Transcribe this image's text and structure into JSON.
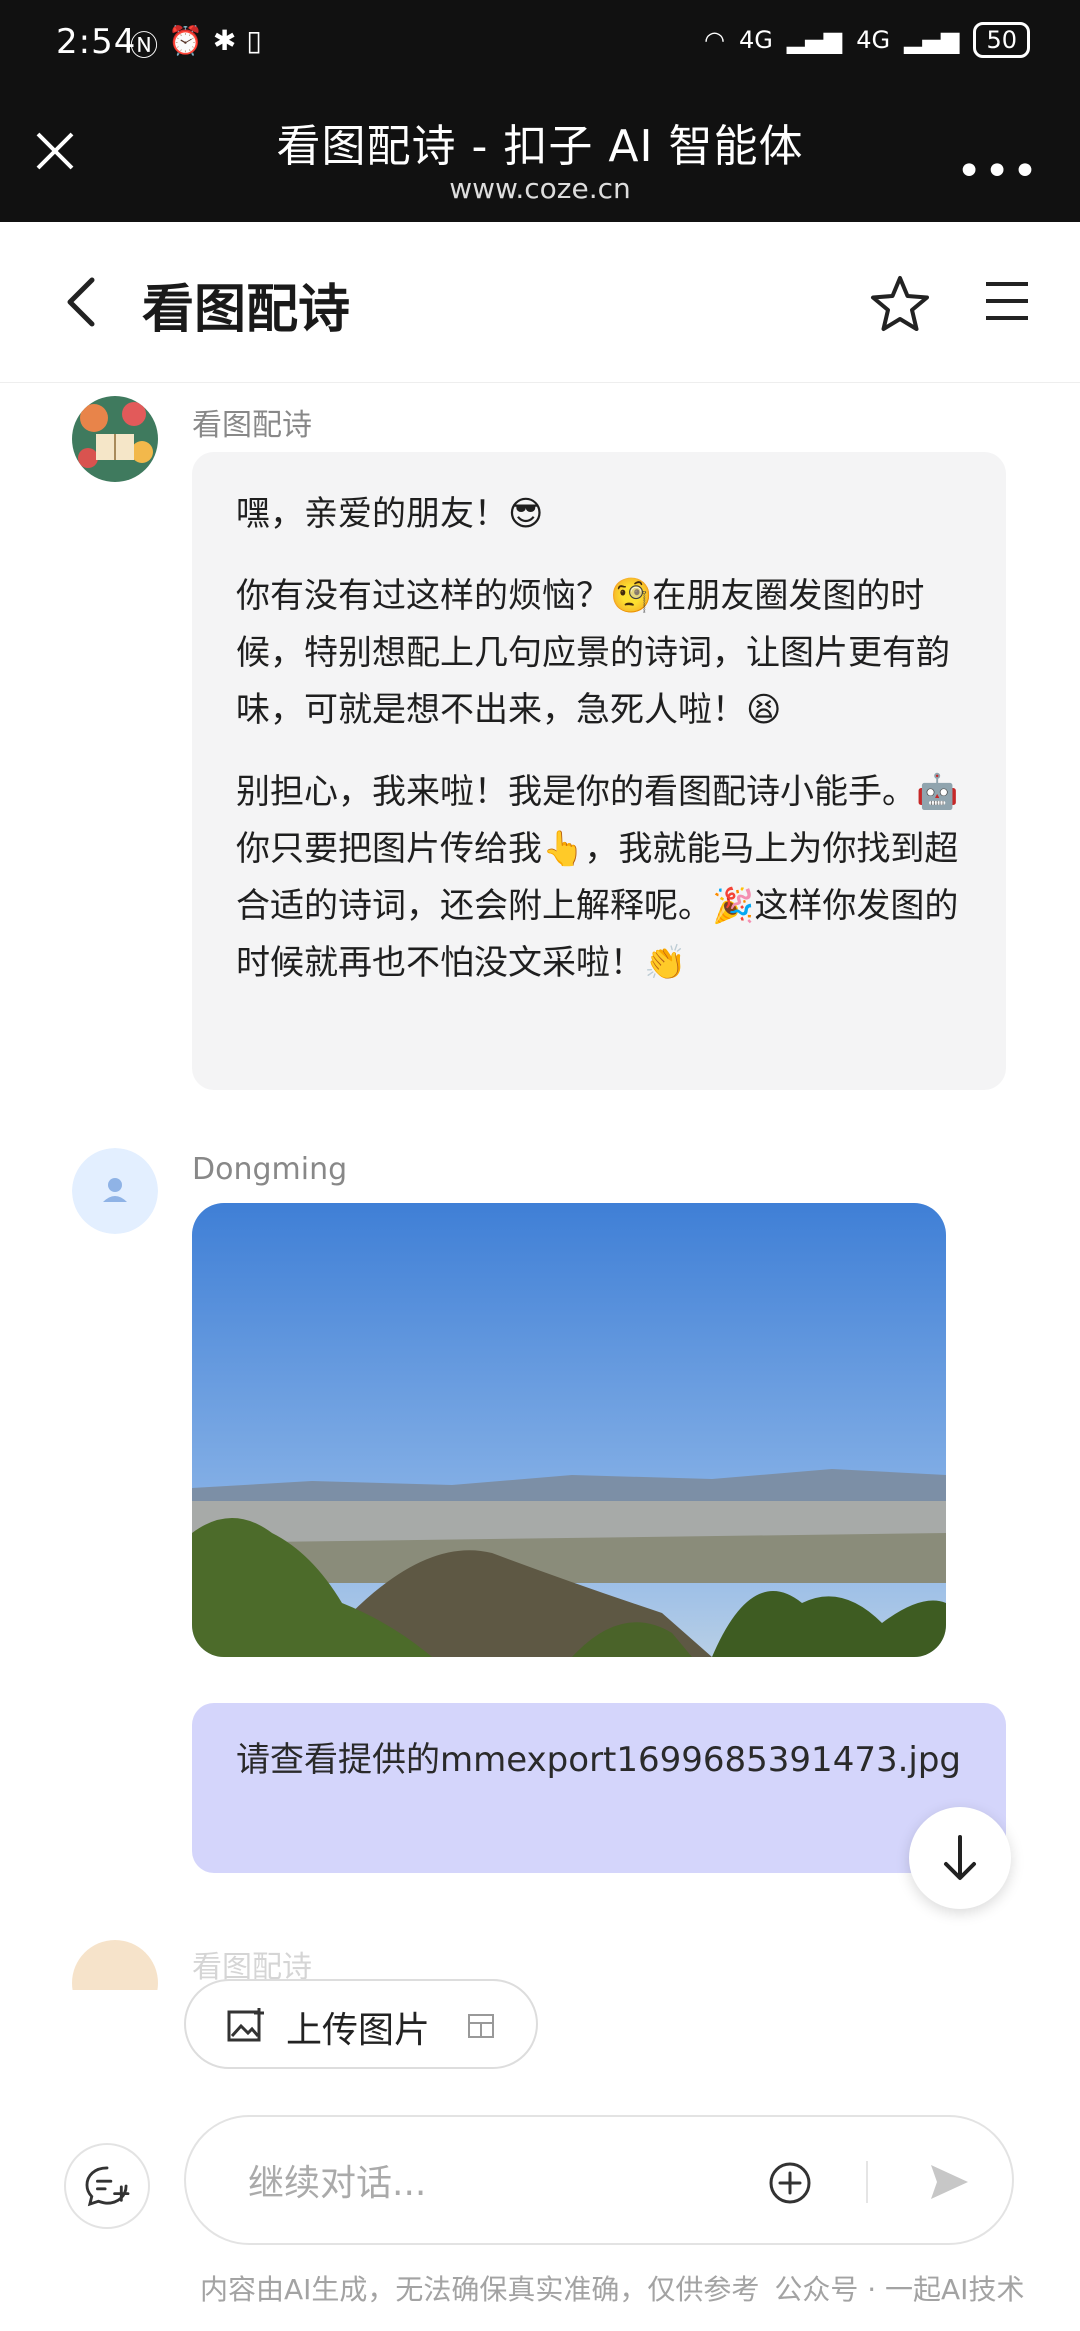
{
  "status_bar": {
    "time": "2:54",
    "network_1": "4G",
    "network_2": "4G",
    "battery": "50"
  },
  "browser": {
    "title": "看图配诗 - 扣子 AI 智能体",
    "url": "www.coze.cn"
  },
  "header": {
    "title": "看图配诗"
  },
  "messages": {
    "bot": {
      "sender": "看图配诗",
      "paragraphs": [
        "嘿，亲爱的朋友！😎",
        "你有没有过这样的烦恼？🧐在朋友圈发图的时候，特别想配上几句应景的诗词，让图片更有韵味，可就是想不出来，急死人啦！😫",
        "别担心，我来啦！我是你的看图配诗小能手。🤖你只要把图片传给我👆，我就能马上为你找到超合适的诗词，还会附上解释呢。🎉这样你发图的时候就再也不怕没文采啦！👏"
      ]
    },
    "user": {
      "sender": "Dongming",
      "text": "请查看提供的mmexport1699685391473.jpg"
    },
    "bot2": {
      "sender": "看图配诗"
    }
  },
  "composer": {
    "upload_label": "上传图片",
    "placeholder": "继续对话..."
  },
  "footer": {
    "disclaimer": "内容由AI生成，无法确保真实准确，仅供参考",
    "watermark": "公众号 · 一起AI技术"
  },
  "colors": {
    "user_bubble": "#d4d5fb",
    "bot_bubble": "#f4f4f5",
    "top_bar": "#111111"
  }
}
